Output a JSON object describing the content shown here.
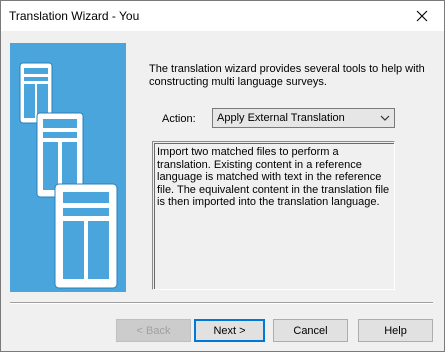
{
  "window": {
    "title": "Translation Wizard - You"
  },
  "intro": {
    "text": "The translation wizard provides several tools to help with constructing multi language surveys."
  },
  "action": {
    "label": "Action:",
    "selected": "Apply External Translation"
  },
  "description": {
    "text": "Import two matched files to perform a translation. Existing content in a reference language is matched with text in the reference file. The equivalent content in the translation file is then imported into the translation language."
  },
  "buttons": {
    "back": "< Back",
    "next": "Next >",
    "cancel": "Cancel",
    "help": "Help"
  },
  "colors": {
    "side_panel": "#4aa5dc",
    "default_button_border": "#0078d7"
  },
  "icons": {
    "close": "close-icon",
    "dropdown": "chevron-down-icon",
    "wizard_illustration": "document-pages-icon"
  }
}
